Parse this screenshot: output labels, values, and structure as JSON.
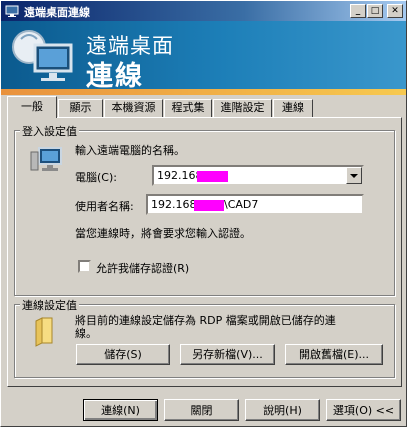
{
  "window": {
    "title": "遠端桌面連線"
  },
  "titlebar_buttons": {
    "minimize": "_",
    "maximize": "□",
    "close": "✕"
  },
  "banner": {
    "line1": "遠端桌面",
    "line2": "連線"
  },
  "tabs": [
    "一般",
    "顯示",
    "本機資源",
    "程式集",
    "進階設定",
    "連線"
  ],
  "login": {
    "group_label": "登入設定值",
    "prompt": "輸入遠端電腦的名稱。",
    "computer_label": "電腦(C):",
    "computer_value": "192.168.",
    "username_label": "使用者名稱:",
    "username_prefix": "192.168.",
    "username_suffix": "\\CAD7",
    "notice": "當您連線時，將會要求您輸入認證。",
    "allow_save_label": "允許我儲存認證(R)",
    "allow_save_checked": false
  },
  "connection": {
    "group_label": "連線設定值",
    "desc_line1": "將目前的連線設定儲存為 RDP 檔案或開啟已儲存的連",
    "desc_line2": "線。",
    "save_button": "儲存(S)",
    "save_as_button": "另存新檔(V)...",
    "open_button": "開啟舊檔(E)..."
  },
  "footer": {
    "connect_button": "連線(N)",
    "close_button": "關閉",
    "help_button": "說明(H)",
    "options_button": "選項(O) <<"
  }
}
